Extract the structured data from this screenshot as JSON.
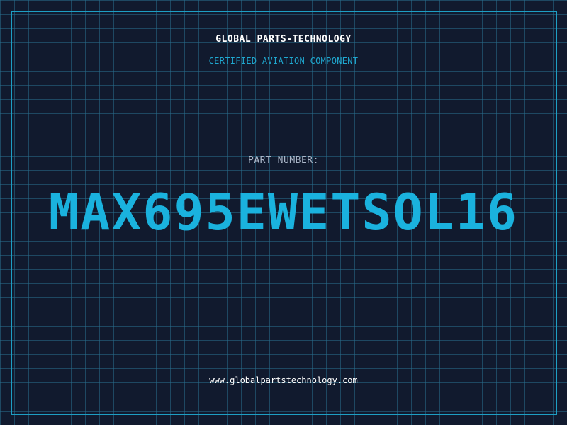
{
  "header": {
    "company": "GLOBAL PARTS-TECHNOLOGY",
    "tagline": "CERTIFIED AVIATION COMPONENT"
  },
  "part": {
    "label": "PART NUMBER:",
    "number": "MAX695EWETSOL16"
  },
  "footer": {
    "website": "www.globalpartstechnology.com"
  },
  "colors": {
    "background": "#111a2e",
    "grid": "#286e8c",
    "frame": "#1d9fc4",
    "accent": "#1ab2de"
  }
}
